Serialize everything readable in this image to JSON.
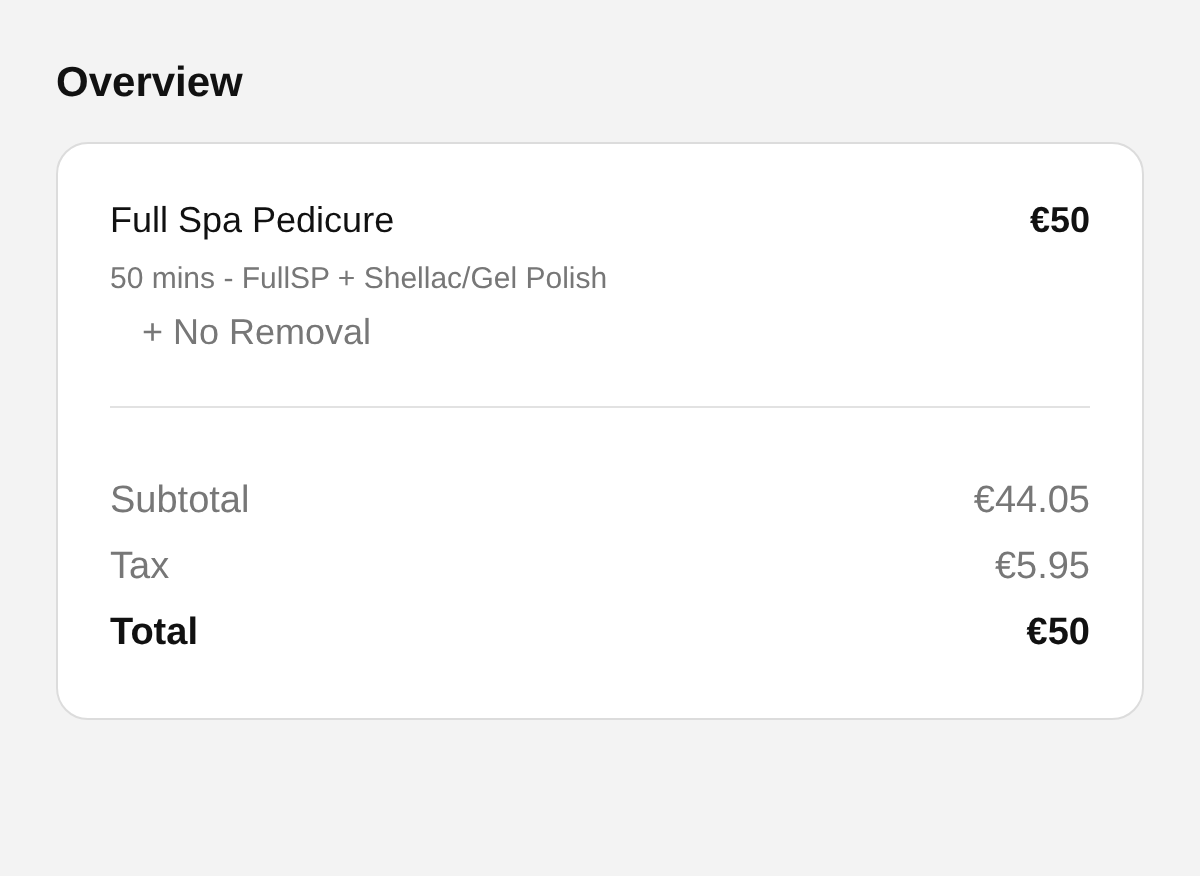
{
  "title": "Overview",
  "item": {
    "name": "Full Spa Pedicure",
    "price": "€50",
    "details": "50 mins - FullSP + Shellac/Gel Polish",
    "addons": [
      "+ No Removal"
    ]
  },
  "summary": [
    {
      "label": "Subtotal",
      "value": "€44.05",
      "kind": "line"
    },
    {
      "label": "Tax",
      "value": "€5.95",
      "kind": "line"
    },
    {
      "label": "Total",
      "value": "€50",
      "kind": "total"
    }
  ]
}
